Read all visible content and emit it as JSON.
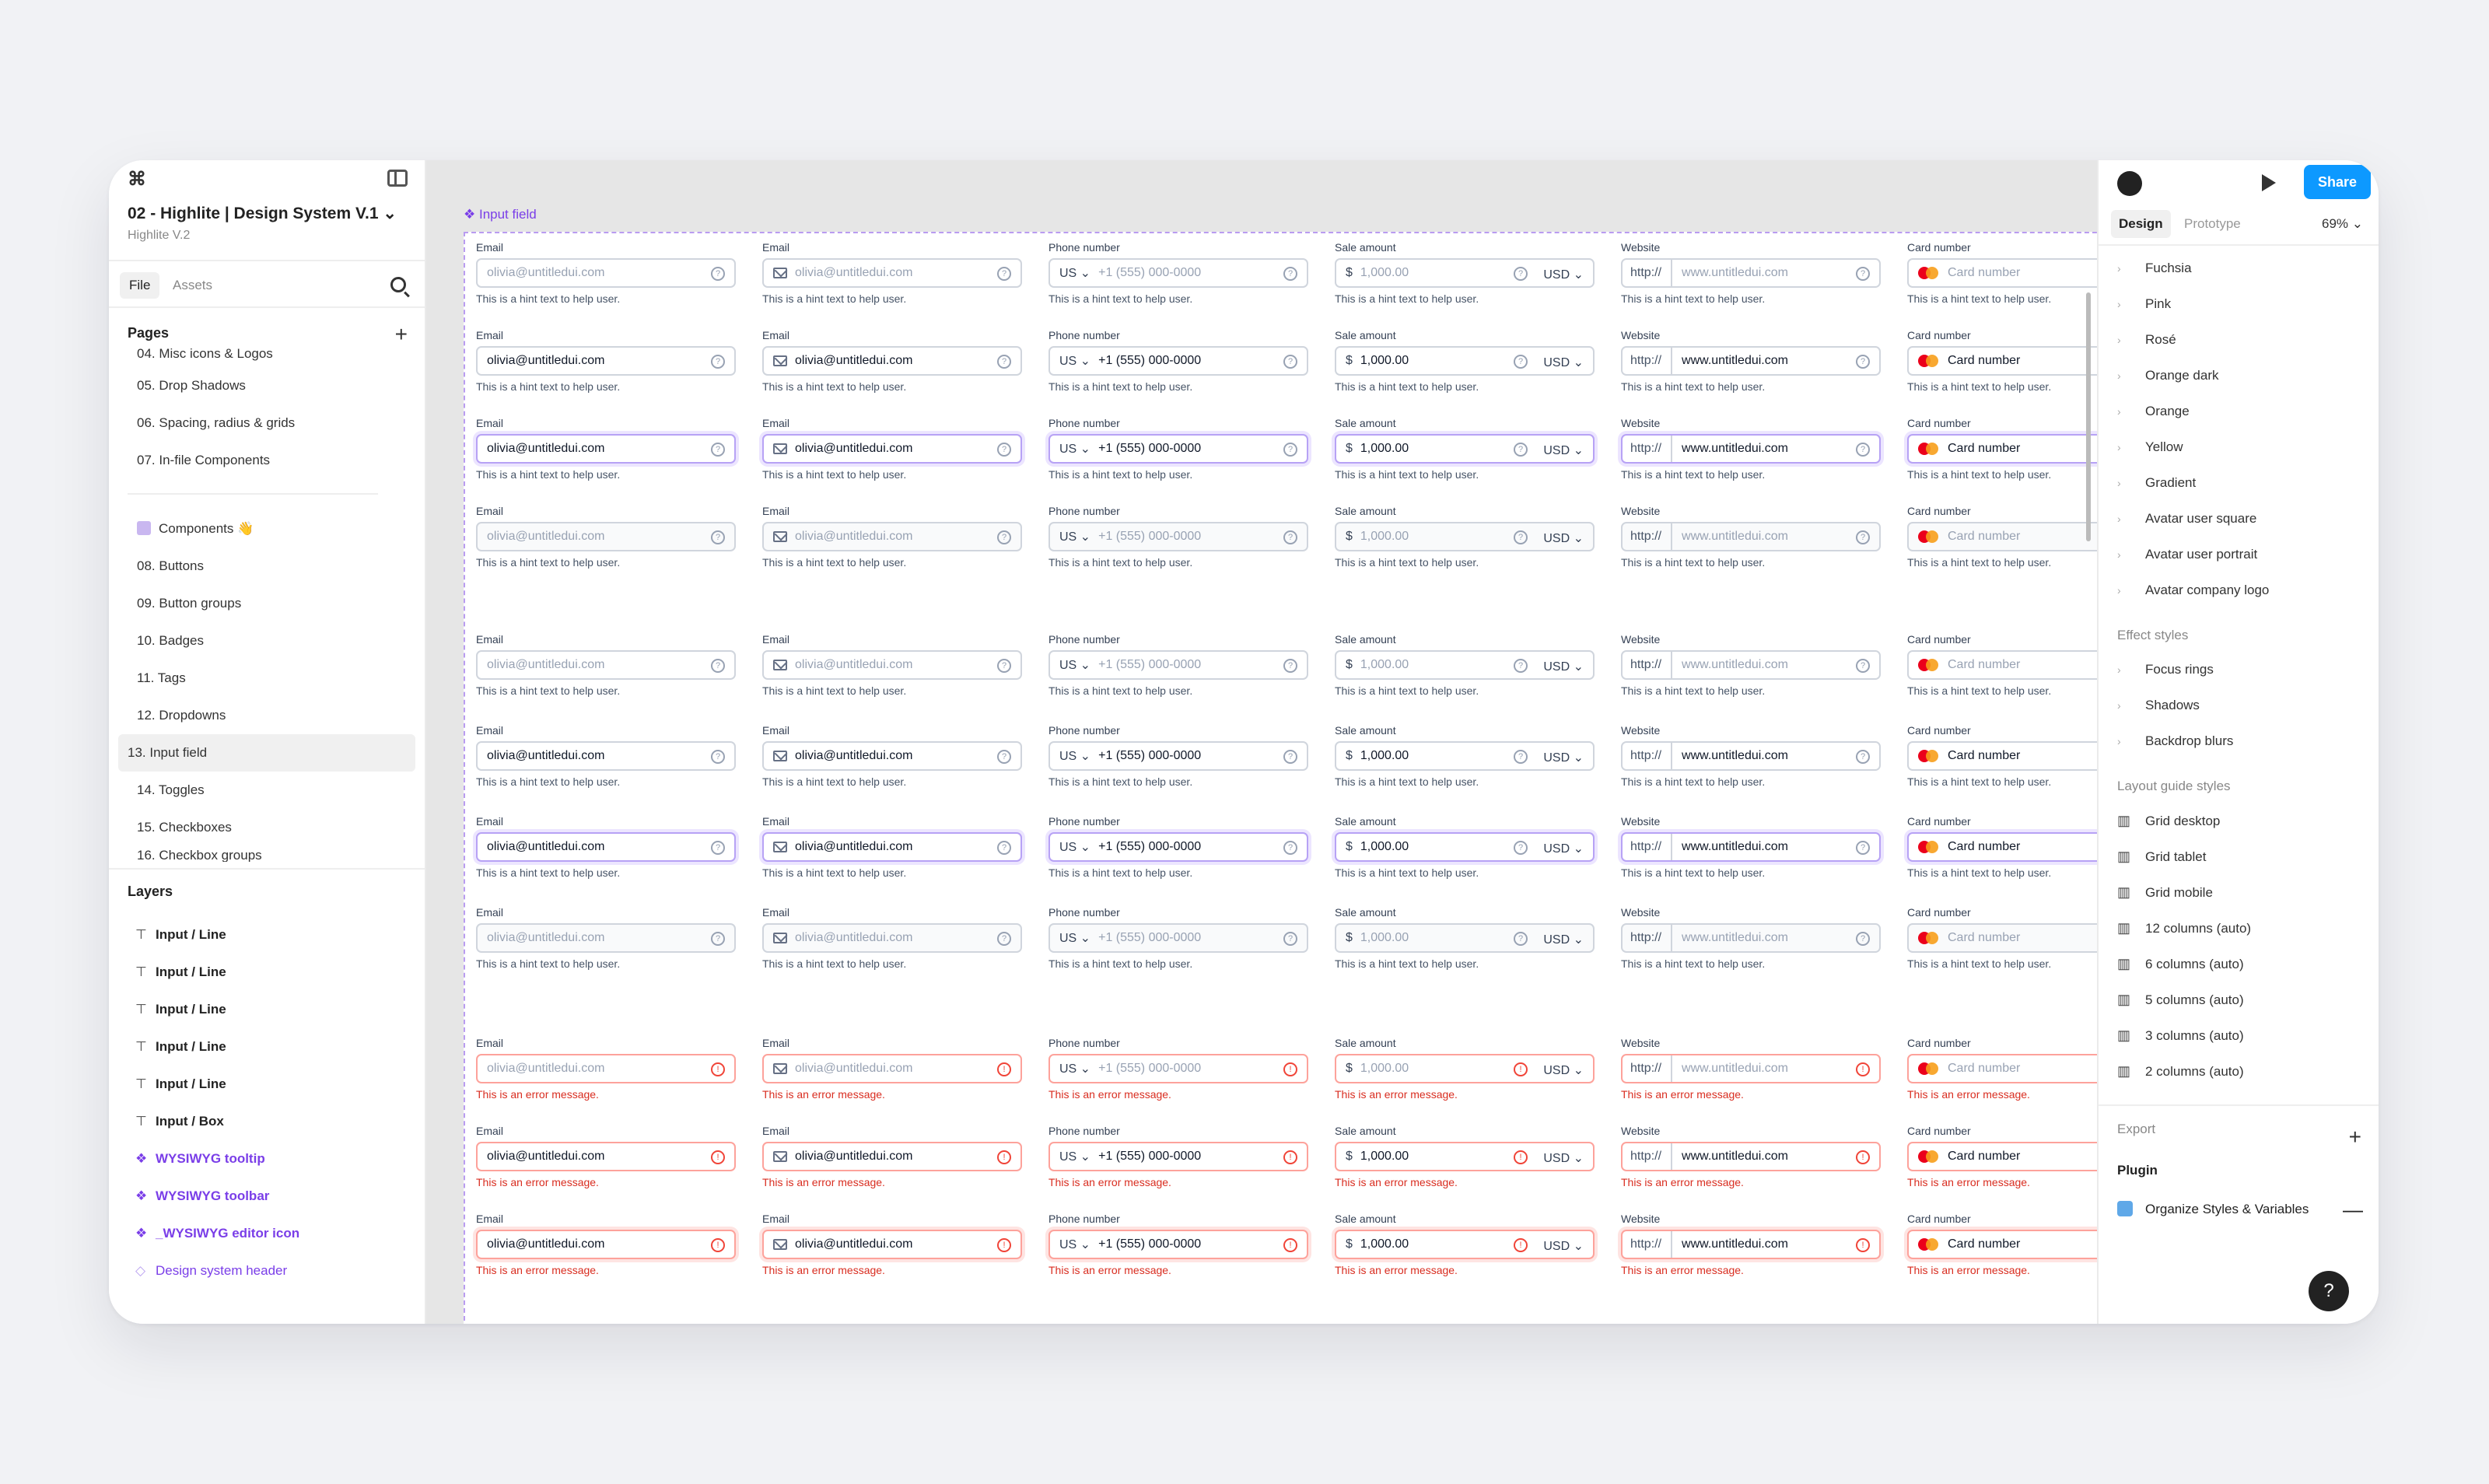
{
  "app": {
    "logo": "⌘",
    "file_title": "02 - Highlite | Design System V.1",
    "file_sub": "Highlite V.2"
  },
  "left_tabs": {
    "file": "File",
    "assets": "Assets"
  },
  "pages_title": "Pages",
  "pages": [
    "04. Misc icons & Logos",
    "05. Drop Shadows",
    "06. Spacing, radius & grids",
    "07. In-file Components"
  ],
  "pages2": [
    "08. Buttons",
    "09. Button groups",
    "10. Badges",
    "11. Tags",
    "12. Dropdowns",
    "13. Input field",
    "14. Toggles",
    "15. Checkboxes",
    "16. Checkbox groups"
  ],
  "components_page": "Components 👋",
  "layers_title": "Layers",
  "layers": [
    "Input / Line",
    "Input / Line",
    "Input / Line",
    "Input / Line",
    "Input / Line",
    "Input / Box"
  ],
  "layers_comp": [
    "WYSIWYG tooltip",
    "WYSIWYG toolbar",
    "_WYSIWYG editor icon"
  ],
  "layer_last": "Design system header",
  "frame_label": "Input field",
  "labels": {
    "email": "Email",
    "phone": "Phone number",
    "sale": "Sale amount",
    "website": "Website",
    "card": "Card number"
  },
  "values": {
    "email": "olivia@untitledui.com",
    "phone_cc": "US",
    "phone": "+1 (555) 000-0000",
    "sale_prefix": "$",
    "sale": "1,000.00",
    "currency": "USD",
    "web_prefix": "http://",
    "website": "www.untitledui.com",
    "card": "Card number"
  },
  "hint": "This is a hint text to help user.",
  "error": "This is an error message.",
  "right": {
    "share": "Share",
    "tab_design": "Design",
    "tab_proto": "Prototype",
    "zoom": "69%",
    "colors": [
      "Fuchsia",
      "Pink",
      "Rosé",
      "Orange dark",
      "Orange",
      "Yellow",
      "Gradient",
      "Avatar user square",
      "Avatar user portrait",
      "Avatar company logo"
    ],
    "effect_title": "Effect styles",
    "effects": [
      "Focus rings",
      "Shadows",
      "Backdrop blurs"
    ],
    "layout_title": "Layout guide styles",
    "layouts": [
      "Grid desktop",
      "Grid tablet",
      "Grid mobile",
      "12 columns (auto)",
      "6 columns (auto)",
      "5 columns (auto)",
      "3 columns (auto)",
      "2 columns (auto)"
    ],
    "export": "Export",
    "plugin": "Plugin",
    "plugin_item": "Organize Styles & Variables",
    "help": "?"
  }
}
